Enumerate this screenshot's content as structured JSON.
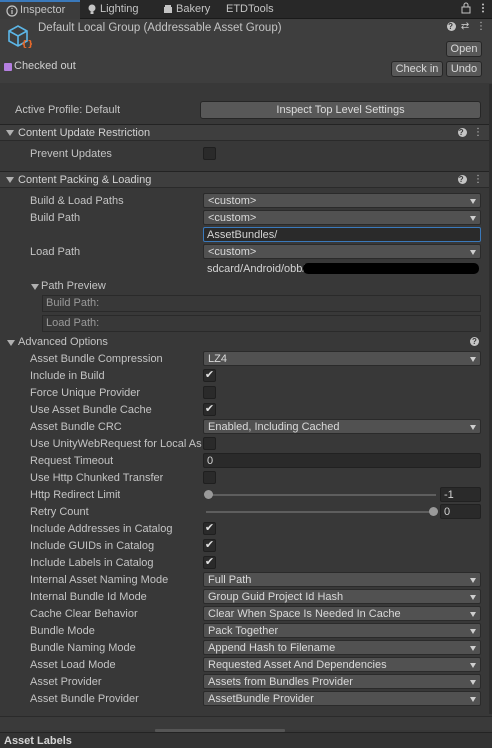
{
  "tabs": [
    {
      "label": "Inspector",
      "icon": "info-icon"
    },
    {
      "label": "Lighting",
      "icon": "bulb-icon"
    },
    {
      "label": "Bakery",
      "icon": "bakery-icon"
    },
    {
      "label": "ETDTools",
      "icon": ""
    }
  ],
  "header": {
    "title": "Default Local Group (Addressable Asset Group)",
    "open_label": "Open",
    "checked_out_label": "Checked out",
    "check_in_label": "Check in",
    "undo_label": "Undo"
  },
  "profile": {
    "label": "Active Profile: Default",
    "inspect_button": "Inspect Top Level Settings"
  },
  "content_update": {
    "title": "Content Update Restriction",
    "prevent_updates_label": "Prevent Updates",
    "prevent_updates_checked": false
  },
  "packing": {
    "title": "Content Packing & Loading",
    "build_load_paths_label": "Build & Load Paths",
    "build_load_paths_value": "<custom>",
    "build_path_label": "Build Path",
    "build_path_value": "<custom>",
    "build_path_text": "AssetBundles/",
    "load_path_label": "Load Path",
    "load_path_value": "<custom>",
    "load_path_text": "sdcard/Android/obb/",
    "path_preview_title": "Path Preview",
    "preview_build_path": "Build Path:",
    "preview_load_path": "Load Path:"
  },
  "advanced": {
    "title": "Advanced Options",
    "compression_label": "Asset Bundle Compression",
    "compression_value": "LZ4",
    "include_in_build_label": "Include in Build",
    "include_in_build": true,
    "force_unique_label": "Force Unique Provider",
    "force_unique": false,
    "use_cache_label": "Use Asset Bundle Cache",
    "use_cache": true,
    "crc_label": "Asset Bundle CRC",
    "crc_value": "Enabled, Including Cached",
    "use_uwr_label": "Use UnityWebRequest for Local Asse",
    "use_uwr": false,
    "timeout_label": "Request Timeout",
    "timeout_value": "0",
    "chunked_label": "Use Http Chunked Transfer",
    "chunked": false,
    "redirect_label": "Http Redirect Limit",
    "redirect_value": "-1",
    "retry_label": "Retry Count",
    "retry_value": "0",
    "include_addresses_label": "Include Addresses in Catalog",
    "include_addresses": true,
    "include_guids_label": "Include GUIDs in Catalog",
    "include_guids": true,
    "include_labels_label": "Include Labels in Catalog",
    "include_labels": true,
    "naming_mode_label": "Internal Asset Naming Mode",
    "naming_mode_value": "Full Path",
    "bundle_id_label": "Internal Bundle Id Mode",
    "bundle_id_value": "Group Guid Project Id Hash",
    "cache_clear_label": "Cache Clear Behavior",
    "cache_clear_value": "Clear When Space Is Needed In Cache",
    "bundle_mode_label": "Bundle Mode",
    "bundle_mode_value": "Pack Together",
    "bundle_naming_label": "Bundle Naming Mode",
    "bundle_naming_value": "Append Hash to Filename",
    "load_mode_label": "Asset Load Mode",
    "load_mode_value": "Requested Asset And Dependencies",
    "asset_provider_label": "Asset Provider",
    "asset_provider_value": "Assets from Bundles Provider",
    "bundle_provider_label": "Asset Bundle Provider",
    "bundle_provider_value": "AssetBundle Provider"
  },
  "footer": {
    "asset_labels": "Asset Labels"
  },
  "colors": {
    "background": "#383838",
    "accent": "#3a79bb",
    "checked_out_icon": "#b47fe0"
  }
}
